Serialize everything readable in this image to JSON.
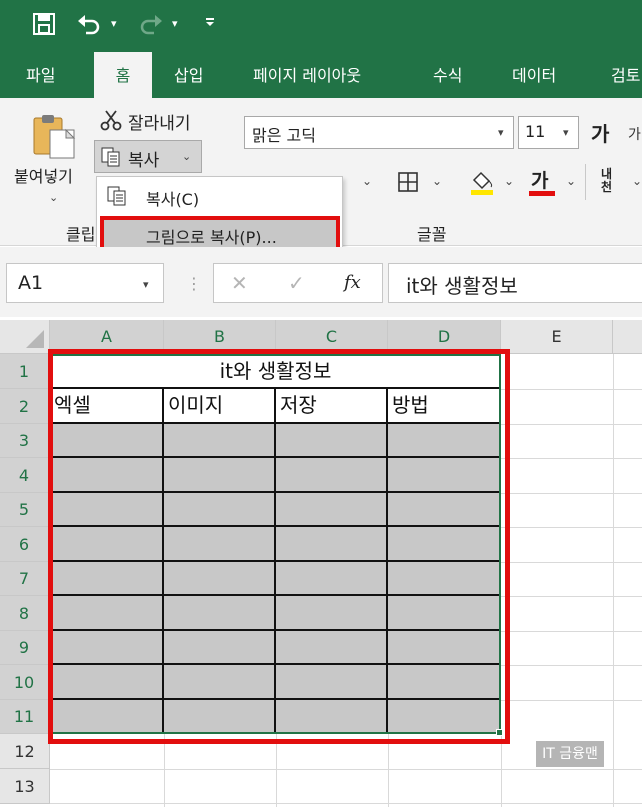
{
  "quick_access": {
    "save_icon": "save-icon",
    "undo_icon": "undo-icon",
    "redo_icon": "redo-icon",
    "customize_icon": "customize-icon"
  },
  "tabs": [
    "파일",
    "홈",
    "삽입",
    "페이지 레이아웃",
    "수식",
    "데이터",
    "검토"
  ],
  "clipboard": {
    "paste_label": "붙여넣기",
    "cut_label": "잘라내기",
    "copy_label": "복사",
    "group_label": "클립",
    "menu": {
      "copy": "복사(C)",
      "copy_picture": "그림으로 복사(P)..."
    }
  },
  "font": {
    "name": "맑은 고딕",
    "size": "11",
    "group_label": "글꼴",
    "grow_glyph": "가",
    "font_color_glyph": "가",
    "phonetic_glyph": "내천"
  },
  "formula_bar": {
    "name_box": "A1",
    "cancel": "✕",
    "enter": "✓",
    "fx": "fx",
    "content": "it와 생활정보"
  },
  "sheet": {
    "columns": [
      "A",
      "B",
      "C",
      "D",
      "E"
    ],
    "rows": [
      "1",
      "2",
      "3",
      "4",
      "5",
      "6",
      "7",
      "8",
      "9",
      "10",
      "11",
      "12",
      "13"
    ],
    "title_cell": "it와 생활정보",
    "headers": [
      "엑셀",
      "이미지",
      "저장",
      "방법"
    ]
  },
  "watermark": "IT 금융맨",
  "colors": {
    "excel_green": "#217346",
    "highlight_red": "#e20e0e",
    "cell_gray": "#c8c8c8"
  }
}
